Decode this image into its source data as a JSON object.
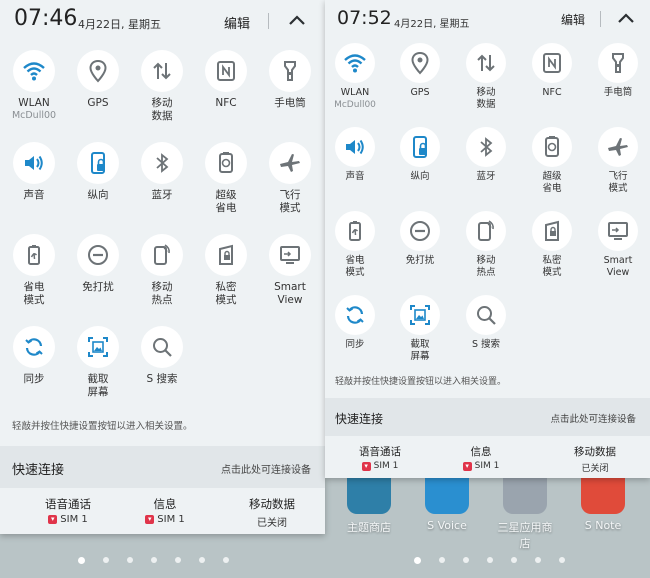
{
  "left": {
    "time": "07:46",
    "date": "4月22日, 星期五",
    "edit_label": "编辑",
    "tiles": [
      {
        "label": "WLAN",
        "sub": "McDull00",
        "icon": "wifi-icon"
      },
      {
        "label": "GPS",
        "icon": "location-icon"
      },
      {
        "label": "移动\n数据",
        "icon": "mobile-data-icon"
      },
      {
        "label": "NFC",
        "icon": "nfc-icon"
      },
      {
        "label": "手电筒",
        "icon": "flashlight-icon"
      },
      {
        "label": "声音",
        "icon": "sound-icon"
      },
      {
        "label": "纵向",
        "icon": "portrait-lock-icon"
      },
      {
        "label": "蓝牙",
        "icon": "bluetooth-icon"
      },
      {
        "label": "超级\n省电",
        "icon": "ultra-power-saving-icon"
      },
      {
        "label": "飞行\n模式",
        "icon": "airplane-icon"
      },
      {
        "label": "省电\n模式",
        "icon": "power-saving-icon"
      },
      {
        "label": "免打扰",
        "icon": "do-not-disturb-icon"
      },
      {
        "label": "移动\n热点",
        "icon": "hotspot-icon"
      },
      {
        "label": "私密\n模式",
        "icon": "private-mode-icon"
      },
      {
        "label": "Smart\nView",
        "icon": "smart-view-icon"
      },
      {
        "label": "同步",
        "icon": "sync-icon"
      },
      {
        "label": "截取\n屏幕",
        "icon": "screenshot-icon"
      },
      {
        "label": "S 搜索",
        "icon": "search-icon"
      }
    ],
    "hint": "轻敲并按住快捷设置按钮以进入相关设置。",
    "quick_connect": {
      "title": "快速连接",
      "hint": "点击此处可连接设备"
    },
    "sim_slots": [
      {
        "title": "语音通话",
        "sub": "SIM 1",
        "sim_badge": true
      },
      {
        "title": "信息",
        "sub": "SIM 1",
        "sim_badge": true
      },
      {
        "title": "移动数据",
        "sub": "已关闭",
        "sim_badge": false
      }
    ]
  },
  "right": {
    "time": "07:52",
    "date": "4月22日, 星期五",
    "edit_label": "编辑",
    "tiles": [
      {
        "label": "WLAN",
        "sub": "McDull00",
        "icon": "wifi-icon"
      },
      {
        "label": "GPS",
        "icon": "location-icon"
      },
      {
        "label": "移动\n数据",
        "icon": "mobile-data-icon"
      },
      {
        "label": "NFC",
        "icon": "nfc-icon"
      },
      {
        "label": "手电筒",
        "icon": "flashlight-icon"
      },
      {
        "label": "声音",
        "icon": "sound-icon"
      },
      {
        "label": "纵向",
        "icon": "portrait-lock-icon"
      },
      {
        "label": "蓝牙",
        "icon": "bluetooth-icon"
      },
      {
        "label": "超级\n省电",
        "icon": "ultra-power-saving-icon"
      },
      {
        "label": "飞行\n模式",
        "icon": "airplane-icon"
      },
      {
        "label": "省电\n模式",
        "icon": "power-saving-icon"
      },
      {
        "label": "免打扰",
        "icon": "do-not-disturb-icon"
      },
      {
        "label": "移动\n热点",
        "icon": "hotspot-icon"
      },
      {
        "label": "私密\n模式",
        "icon": "private-mode-icon"
      },
      {
        "label": "Smart\nView",
        "icon": "smart-view-icon"
      },
      {
        "label": "同步",
        "icon": "sync-icon"
      },
      {
        "label": "截取\n屏幕",
        "icon": "screenshot-icon"
      },
      {
        "label": "S 搜索",
        "icon": "search-icon"
      }
    ],
    "hint": "轻敲并按住快捷设置按钮以进入相关设置。",
    "quick_connect": {
      "title": "快速连接",
      "hint": "点击此处可连接设备"
    },
    "sim_slots": [
      {
        "title": "语音通话",
        "sub": "SIM 1",
        "sim_badge": true
      },
      {
        "title": "信息",
        "sub": "SIM 1",
        "sim_badge": true
      },
      {
        "title": "移动数据",
        "sub": "已关闭",
        "sim_badge": false
      }
    ],
    "home_apps": [
      {
        "name": "主题商店",
        "icon": "theme-store-icon",
        "color": "#2e7fa8"
      },
      {
        "name": "S Voice",
        "icon": "s-voice-icon",
        "color": "#2a8fd0"
      },
      {
        "name": "三星应用商店",
        "icon": "galaxy-apps-icon",
        "color": "#9aa4ae"
      },
      {
        "name": "S Note",
        "icon": "s-note-icon",
        "color": "#e04b3a"
      }
    ]
  },
  "colors": {
    "accent": "#1e88c9",
    "icon_gray": "#6d7377",
    "sim_red": "#e0344a"
  }
}
